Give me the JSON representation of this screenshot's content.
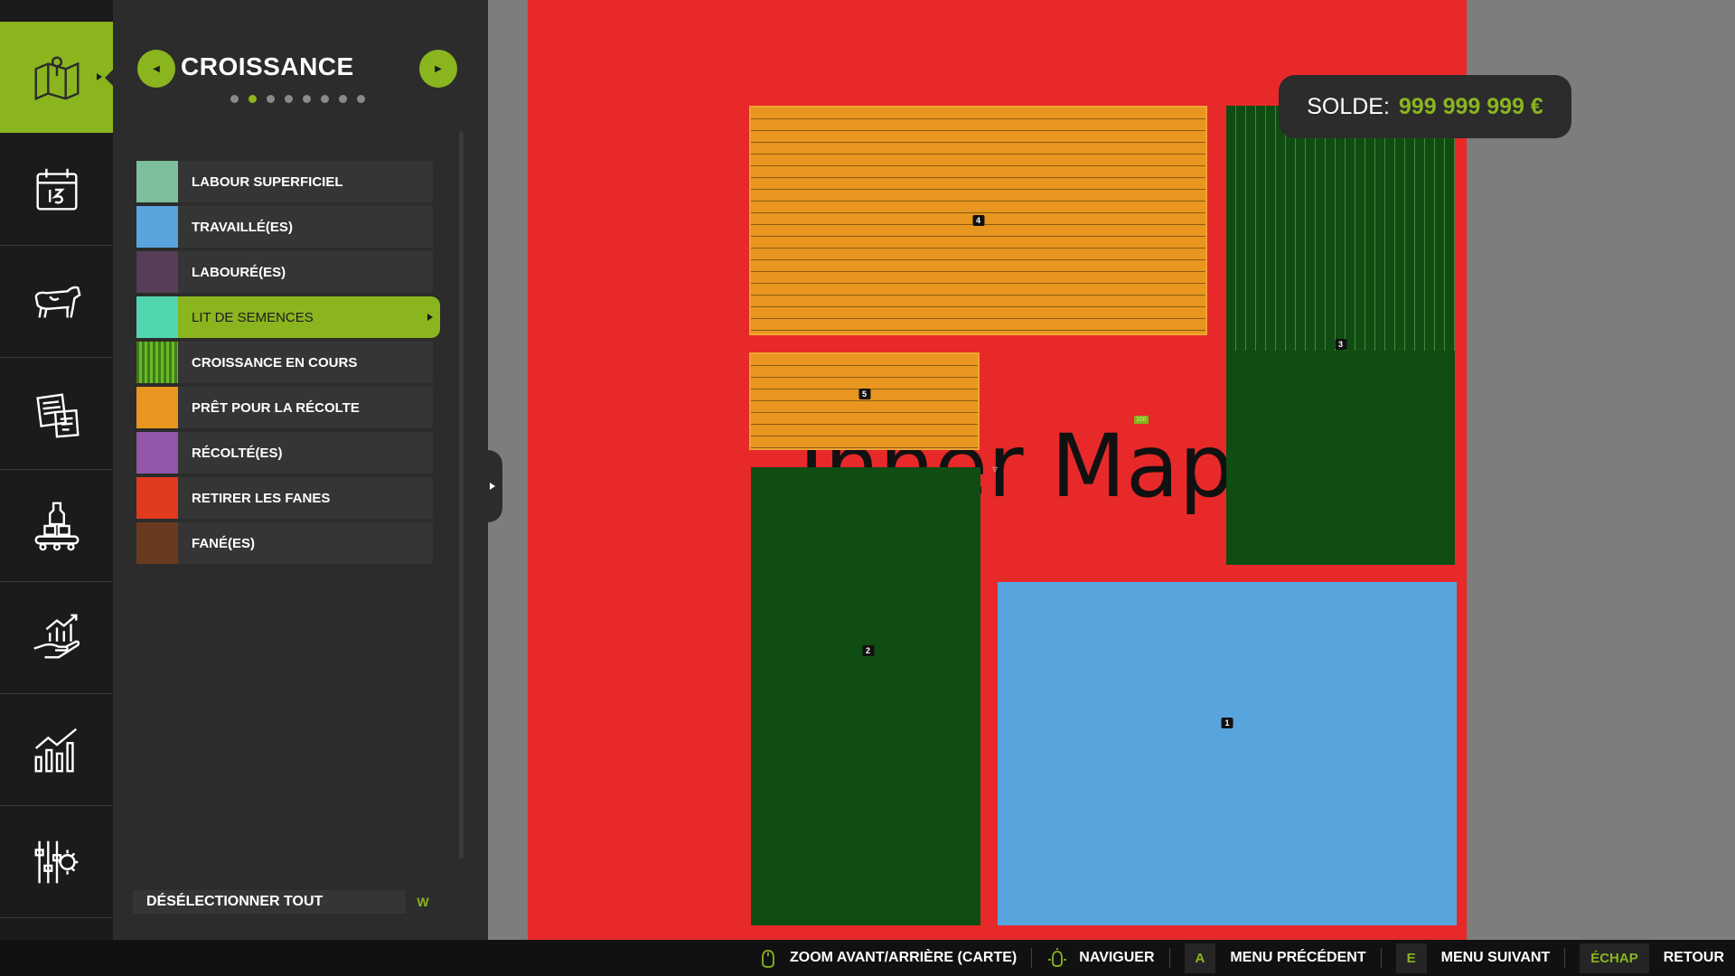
{
  "panel": {
    "title": "CROISSANCE",
    "page_dots": {
      "count": 8,
      "active_index": 1
    }
  },
  "legend": [
    {
      "label": "LABOUR SUPERFICIEL",
      "color": "#7dbf9a"
    },
    {
      "label": "TRAVAILLÉ(ES)",
      "color": "#58a5de"
    },
    {
      "label": "LABOURÉ(ES)",
      "color": "#573d58"
    },
    {
      "label": "LIT DE SEMENCES",
      "color": "#52d6b0",
      "selected": true
    },
    {
      "label": "CROISSANCE EN COURS",
      "color": "#4e9a1d"
    },
    {
      "label": "PRÊT POUR LA RÉCOLTE",
      "color": "#e8961f"
    },
    {
      "label": "RÉCOLTÉ(ES)",
      "color": "#9356a8"
    },
    {
      "label": "RETIRER LES FANES",
      "color": "#e03a1f"
    },
    {
      "label": "FANÉ(ES)",
      "color": "#6a3a1e"
    }
  ],
  "deselect": {
    "label": "DÉSÉLECTIONNER TOUT",
    "key": "W"
  },
  "balance": {
    "label": "SOLDE:",
    "value": "999 999 999 €"
  },
  "map": {
    "placeholder_text": "Inner Map",
    "fields": [
      "4",
      "5",
      "3",
      "2",
      "1"
    ],
    "small_marker": "100"
  },
  "bottom_bar": {
    "zoom": "ZOOM AVANT/ARRIÈRE (CARTE)",
    "navigate": "NAVIGUER",
    "prev_key": "A",
    "prev": "MENU PRÉCÉDENT",
    "next_key": "E",
    "next": "MENU SUIVANT",
    "back_key": "ÉCHAP",
    "back": "RETOUR"
  },
  "colors": {
    "accent": "#8ab51f",
    "panel": "#2b2c2b",
    "rail": "#1b1b1b",
    "map_bg": "#e7292a"
  }
}
